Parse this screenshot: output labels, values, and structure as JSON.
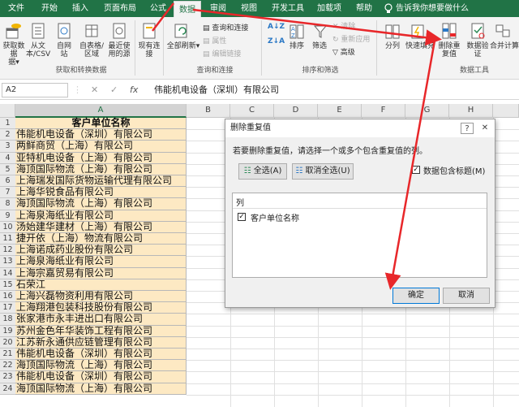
{
  "tabs": [
    "文件",
    "开始",
    "插入",
    "页面布局",
    "公式",
    "数据",
    "审阅",
    "视图",
    "开发工具",
    "加载项",
    "帮助"
  ],
  "tell_me": "告诉我你想要做什么",
  "ribbon": {
    "get_data": "获取数据",
    "get_data_sub": "据",
    "from_text_csv": "从文本/CSV",
    "from_web": "自网站",
    "from_table": "自表格/区域",
    "recent_sources": "最近使用的源",
    "existing_connections": "现有连接",
    "group_get_transform": "获取和转换数据",
    "refresh_all": "全部刷新",
    "queries_connections": "查询和连接",
    "properties": "属性",
    "edit_links": "编辑链接",
    "group_queries": "查询和连接",
    "sort_az": "A↓Z",
    "sort_za": "Z↓A",
    "sort": "排序",
    "filter": "筛选",
    "clear": "清除",
    "reapply": "重新应用",
    "advanced": "高级",
    "group_sort_filter": "排序和筛选",
    "text_to_columns": "分列",
    "flash_fill": "快速填充",
    "remove_duplicates": "删除重复值",
    "data_validation": "数据验证",
    "consolidate": "合并计算",
    "group_data_tools": "数据工具"
  },
  "formula_bar": {
    "name_box": "A2",
    "formula": "伟能机电设备（深圳）有限公司",
    "cancel": "✕",
    "confirm": "✓",
    "fx": "fx"
  },
  "columns": [
    "A",
    "B",
    "C",
    "D",
    "E",
    "F",
    "G",
    "H"
  ],
  "rows": [
    "1",
    "2",
    "3",
    "4",
    "5",
    "6",
    "7",
    "8",
    "9",
    "10",
    "11",
    "12",
    "13",
    "14",
    "15",
    "16",
    "17",
    "18",
    "19",
    "20",
    "21",
    "22",
    "23",
    "24"
  ],
  "cells": [
    "客户单位名称",
    "伟能机电设备（深圳）有限公司",
    "两鲜商贸（上海）有限公司",
    "亚特机电设备（上海）有限公司",
    "海顶国际物流（上海）有限公司",
    "上海瑞发国际货物运输代理有限公司",
    "上海华锐食品有限公司",
    "海顶国际物流（上海）有限公司",
    "上海泉海纸业有限公司",
    "汤始建华建材（上海）有限公司",
    "捷开依（上海）物流有限公司",
    "上海诺成药业股份有限公司",
    "上海泉海纸业有限公司",
    "上海宗嘉贸易有限公司",
    "石荣江",
    "上海兴磊物资利用有限公司",
    "上海翔港包装科技股份有限公司",
    "张家港市永丰进出口有限公司",
    "苏州金色年华装饰工程有限公司",
    "江苏新永通供应链管理有限公司",
    "伟能机电设备（深圳）有限公司",
    "海顶国际物流（上海）有限公司",
    "伟能机电设备（深圳）有限公司",
    "海顶国际物流（上海）有限公司"
  ],
  "dialog": {
    "title": "删除重复值",
    "help": "?",
    "close": "✕",
    "instruction": "若要删除重复值，请选择一个或多个包含重复值的列。",
    "select_all": "全选(A)",
    "unselect_all": "取消全选(U)",
    "has_headers": "数据包含标题(M)",
    "list_header": "列",
    "list_items": [
      "客户单位名称"
    ],
    "ok": "确定",
    "cancel": "取消"
  },
  "colors": {
    "excel_green": "#217346",
    "cell_fill": "#fde9c3",
    "arrow": "#e8272a"
  }
}
